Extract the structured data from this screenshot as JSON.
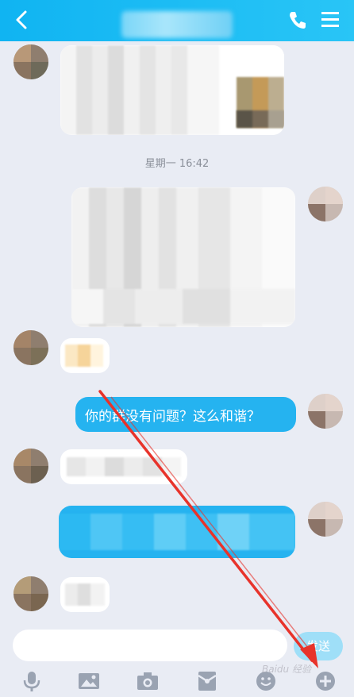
{
  "header": {
    "title": "",
    "back_icon": "chevron-left-icon",
    "phone_icon": "phone-icon",
    "menu_icon": "hamburger-menu-icon",
    "color": "#19bcf4"
  },
  "chat": {
    "timestamp": "星期一 16:42",
    "my_message": "你的群没有问题？这么和谐？"
  },
  "composer": {
    "input_value": "",
    "send_label": "发送"
  },
  "toolbar": {
    "icons": [
      "microphone-icon",
      "image-icon",
      "camera-icon",
      "red-packet-icon",
      "emoji-icon",
      "plus-icon"
    ]
  },
  "watermark": "Baidu 经验"
}
